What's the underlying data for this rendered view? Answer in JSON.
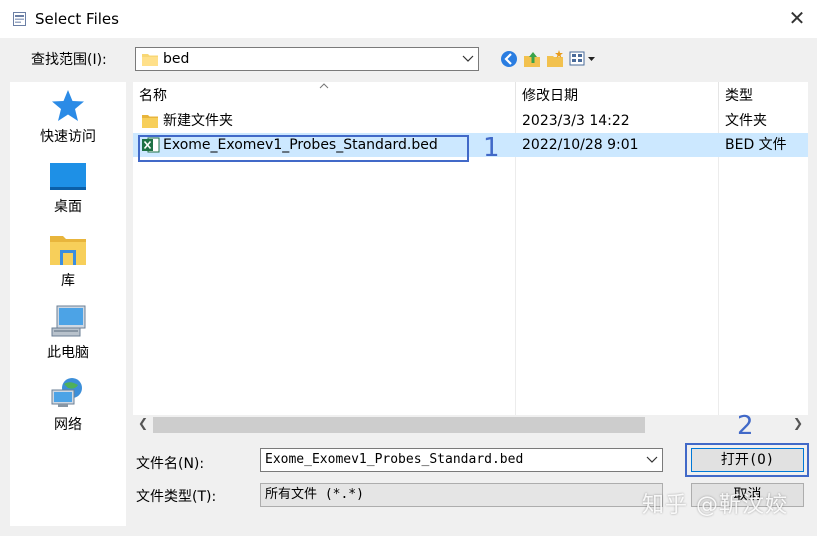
{
  "window": {
    "title": "Select Files",
    "close_glyph": "✕"
  },
  "look_in": {
    "label": "查找范围(I):",
    "value": "bed"
  },
  "places": [
    {
      "label": "快速访问",
      "icon": "star-icon"
    },
    {
      "label": "桌面",
      "icon": "desktop-icon"
    },
    {
      "label": "库",
      "icon": "library-folder-icon"
    },
    {
      "label": "此电脑",
      "icon": "computer-icon"
    },
    {
      "label": "网络",
      "icon": "network-icon"
    }
  ],
  "file_list": {
    "columns": [
      "名称",
      "修改日期",
      "类型"
    ],
    "rows": [
      {
        "name": "新建文件夹",
        "date": "2023/3/3 14:22",
        "type": "文件夹",
        "icon": "folder-icon",
        "selected": false
      },
      {
        "name": "Exome_Exomev1_Probes_Standard.bed",
        "date": "2022/10/28 9:01",
        "type": "BED 文件",
        "icon": "excel-file-icon",
        "selected": true
      }
    ]
  },
  "filename": {
    "label": "文件名(N):",
    "value": "Exome_Exomev1_Probes_Standard.bed"
  },
  "filetype": {
    "label": "文件类型(T):",
    "value": "所有文件 (*.*)"
  },
  "buttons": {
    "open": "打开(O)",
    "cancel": "取消"
  },
  "annotations": {
    "one": "1",
    "two": "2"
  },
  "watermark": "知乎 @靳汶姣",
  "colors": {
    "selection": "#cce8ff",
    "annotation": "#4169c8",
    "accent": "#0078d7"
  }
}
